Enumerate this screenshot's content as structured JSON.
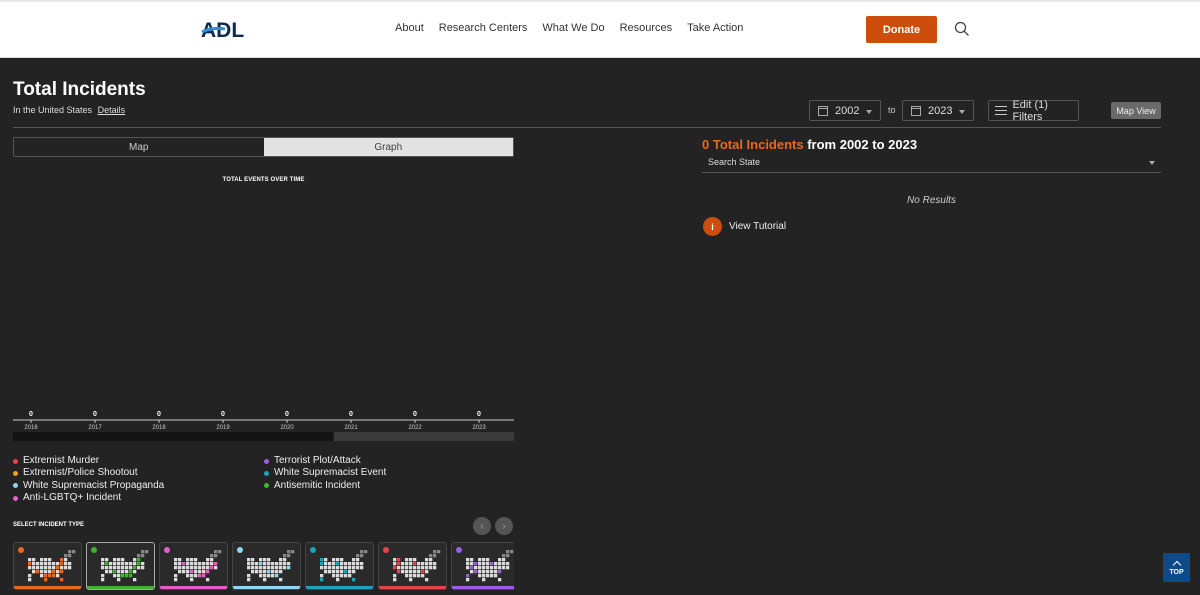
{
  "header": {
    "logo_text": "ADL",
    "nav": [
      "About",
      "Research Centers",
      "What We Do",
      "Resources",
      "Take Action"
    ],
    "donate_label": "Donate"
  },
  "page": {
    "title": "Total Incidents",
    "subtitle": "In the United States",
    "details_link": "Details"
  },
  "controls": {
    "from_year": "2002",
    "to_label": "to",
    "to_year": "2023",
    "filters_label": "Edit (1) Filters",
    "map_view_label": "Map View"
  },
  "view_toggle": {
    "map": "Map",
    "graph": "Graph",
    "active": "Graph"
  },
  "chart_data": {
    "type": "bar",
    "title": "TOTAL EVENTS OVER TIME",
    "categories": [
      "2016",
      "2017",
      "2018",
      "2019",
      "2020",
      "2021",
      "2022",
      "2023"
    ],
    "values": [
      0,
      0,
      0,
      0,
      0,
      0,
      0,
      0
    ],
    "xlabel": "",
    "ylabel": "",
    "scroll_position": 0.64
  },
  "legend": {
    "left": [
      {
        "label": "Extremist Murder",
        "color": "#e8434a"
      },
      {
        "label": "Extremist/Police Shootout",
        "color": "#f0a21e"
      },
      {
        "label": "White Supremacist Propaganda",
        "color": "#8fd6ef"
      },
      {
        "label": "Anti-LGBTQ+ Incident",
        "color": "#e45ec9"
      }
    ],
    "right": [
      {
        "label": "Terrorist Plot/Attack",
        "color": "#9a5fe0"
      },
      {
        "label": "White Supremacist Event",
        "color": "#1ea2be"
      },
      {
        "label": "Antisemitic Incident",
        "color": "#3cb52c"
      }
    ]
  },
  "select_incident": {
    "label": "SELECT INCIDENT TYPE",
    "prev_icon": "‹",
    "next_icon": "›",
    "cards": [
      {
        "color": "#e8691f",
        "selected": false
      },
      {
        "color": "#3cb52c",
        "selected": true
      },
      {
        "color": "#e45ec9",
        "selected": false
      },
      {
        "color": "#8fd6ef",
        "selected": false
      },
      {
        "color": "#1ea2be",
        "selected": false
      },
      {
        "color": "#e8434a",
        "selected": false
      },
      {
        "color": "#9a5fe0",
        "selected": false
      }
    ]
  },
  "results": {
    "count": "0 Total Incidents",
    "range_text": " from 2002 to 2023",
    "search_placeholder": "Search State",
    "no_results": "No Results",
    "tutorial_icon": "i",
    "tutorial_label": "View Tutorial"
  },
  "top_button": "TOP"
}
